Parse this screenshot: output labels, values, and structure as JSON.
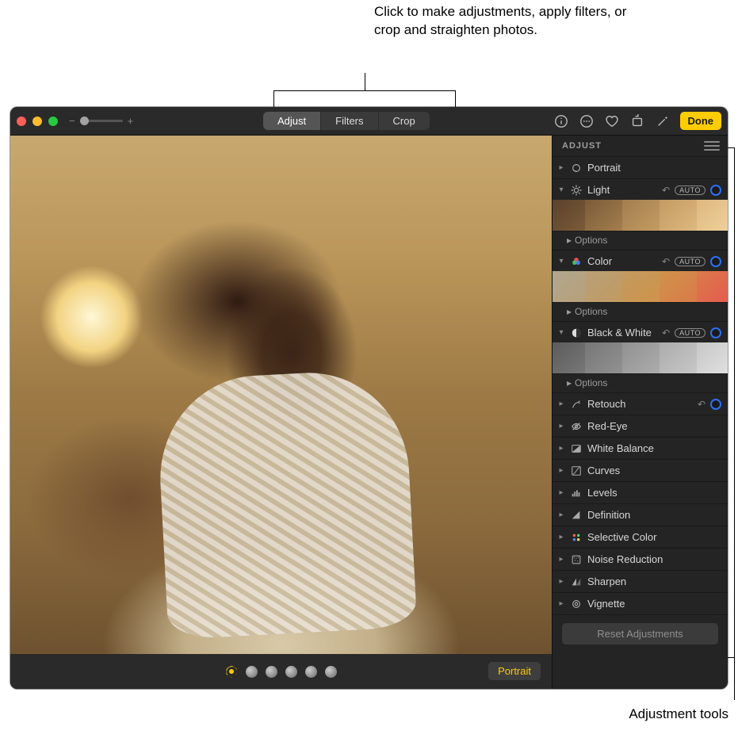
{
  "callouts": {
    "top": "Click to make adjustments, apply filters, or crop and straighten photos.",
    "bottom": "Adjustment tools"
  },
  "toolbar": {
    "zoom_minus": "−",
    "zoom_plus": "+",
    "segments": {
      "adjust": "Adjust",
      "filters": "Filters",
      "crop": "Crop"
    },
    "done": "Done"
  },
  "bottom": {
    "portrait": "Portrait"
  },
  "sidebar": {
    "header": "ADJUST",
    "portrait": "Portrait",
    "light": "Light",
    "color": "Color",
    "bw": "Black & White",
    "retouch": "Retouch",
    "redeye": "Red-Eye",
    "whitebalance": "White Balance",
    "curves": "Curves",
    "levels": "Levels",
    "definition": "Definition",
    "selectivecolor": "Selective Color",
    "noisereduction": "Noise Reduction",
    "sharpen": "Sharpen",
    "vignette": "Vignette",
    "options": "Options",
    "auto": "AUTO",
    "reset": "Reset Adjustments"
  }
}
